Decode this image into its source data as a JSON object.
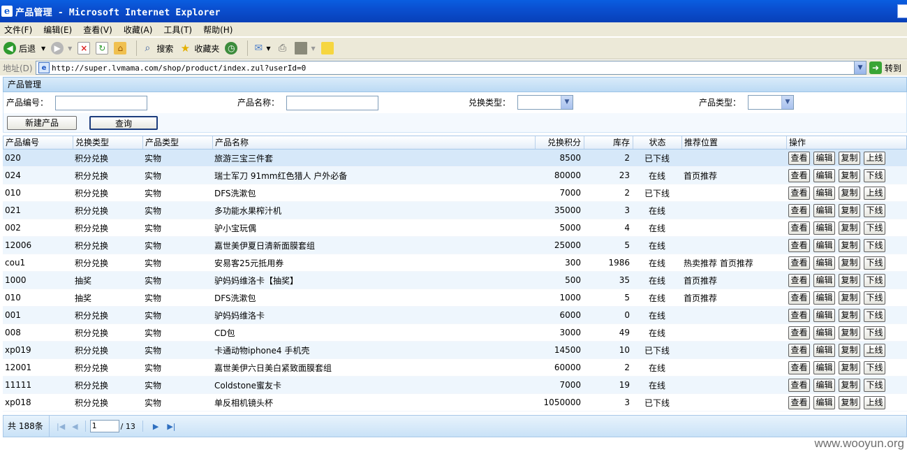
{
  "window": {
    "title": "产品管理 - Microsoft Internet Explorer"
  },
  "menu": [
    "文件(F)",
    "编辑(E)",
    "查看(V)",
    "收藏(A)",
    "工具(T)",
    "帮助(H)"
  ],
  "toolbar": {
    "back": "后退",
    "search": "搜索",
    "favorites": "收藏夹"
  },
  "address": {
    "label": "地址(D)",
    "url": "http://super.lvmama.com/shop/product/index.zul?userId=0",
    "go": "转到"
  },
  "panel": {
    "title": "产品管理"
  },
  "filters": {
    "product_code_label": "产品编号：",
    "product_name_label": "产品名称：",
    "exchange_type_label": "兑换类型：",
    "product_type_label": "产品类型："
  },
  "buttons": {
    "new_product": "新建产品",
    "query": "查询"
  },
  "grid": {
    "columns": [
      "产品编号",
      "兑换类型",
      "产品类型",
      "产品名称",
      "兑换积分",
      "库存",
      "状态",
      "推荐位置",
      "操作"
    ],
    "op_view": "查看",
    "op_edit": "编辑",
    "op_copy": "复制",
    "rows": [
      {
        "code": "020",
        "exchange": "积分兑换",
        "ptype": "实物",
        "name": "旅游三宝三件套",
        "points": "8500",
        "stock": "2",
        "status": "已下线",
        "rec": "",
        "toggle": "上线"
      },
      {
        "code": "024",
        "exchange": "积分兑换",
        "ptype": "实物",
        "name": "瑞士军刀 91mm红色猎人 户外必备",
        "points": "80000",
        "stock": "23",
        "status": "在线",
        "rec": "首页推荐",
        "toggle": "下线"
      },
      {
        "code": "010",
        "exchange": "积分兑换",
        "ptype": "实物",
        "name": "DFS洗漱包",
        "points": "7000",
        "stock": "2",
        "status": "已下线",
        "rec": "",
        "toggle": "上线"
      },
      {
        "code": "021",
        "exchange": "积分兑换",
        "ptype": "实物",
        "name": "多功能水果榨汁机",
        "points": "35000",
        "stock": "3",
        "status": "在线",
        "rec": "",
        "toggle": "下线"
      },
      {
        "code": "002",
        "exchange": "积分兑换",
        "ptype": "实物",
        "name": "驴小宝玩偶",
        "points": "5000",
        "stock": "4",
        "status": "在线",
        "rec": "",
        "toggle": "下线"
      },
      {
        "code": "12006",
        "exchange": "积分兑换",
        "ptype": "实物",
        "name": "嘉世美伊夏日清新面膜套组",
        "points": "25000",
        "stock": "5",
        "status": "在线",
        "rec": "",
        "toggle": "下线"
      },
      {
        "code": "cou1",
        "exchange": "积分兑换",
        "ptype": "实物",
        "name": "安易客25元抵用券",
        "points": "300",
        "stock": "1986",
        "status": "在线",
        "rec": "热卖推荐 首页推荐",
        "toggle": "下线"
      },
      {
        "code": "1000",
        "exchange": "抽奖",
        "ptype": "实物",
        "name": "驴妈妈维洛卡【抽奖】",
        "points": "500",
        "stock": "35",
        "status": "在线",
        "rec": "首页推荐",
        "toggle": "下线"
      },
      {
        "code": "010",
        "exchange": "抽奖",
        "ptype": "实物",
        "name": "DFS洗漱包",
        "points": "1000",
        "stock": "5",
        "status": "在线",
        "rec": "首页推荐",
        "toggle": "下线"
      },
      {
        "code": "001",
        "exchange": "积分兑换",
        "ptype": "实物",
        "name": "驴妈妈维洛卡",
        "points": "6000",
        "stock": "0",
        "status": "在线",
        "rec": "",
        "toggle": "下线"
      },
      {
        "code": "008",
        "exchange": "积分兑换",
        "ptype": "实物",
        "name": "CD包",
        "points": "3000",
        "stock": "49",
        "status": "在线",
        "rec": "",
        "toggle": "下线"
      },
      {
        "code": "xp019",
        "exchange": "积分兑换",
        "ptype": "实物",
        "name": "卡通动物iphone4 手机壳",
        "points": "14500",
        "stock": "10",
        "status": "已下线",
        "rec": "",
        "toggle": "上线"
      },
      {
        "code": "12001",
        "exchange": "积分兑换",
        "ptype": "实物",
        "name": "嘉世美伊六日美白紧致面膜套组",
        "points": "60000",
        "stock": "2",
        "status": "在线",
        "rec": "",
        "toggle": "下线"
      },
      {
        "code": "11111",
        "exchange": "积分兑换",
        "ptype": "实物",
        "name": "Coldstone蜜友卡",
        "points": "7000",
        "stock": "19",
        "status": "在线",
        "rec": "",
        "toggle": "下线"
      },
      {
        "code": "xp018",
        "exchange": "积分兑换",
        "ptype": "实物",
        "name": "单反相机镜头杯",
        "points": "1050000",
        "stock": "3",
        "status": "已下线",
        "rec": "",
        "toggle": "上线"
      }
    ]
  },
  "pager": {
    "total": "共 188条",
    "page": "1",
    "page_total": "/ 13"
  },
  "watermark": "www.wooyun.org"
}
